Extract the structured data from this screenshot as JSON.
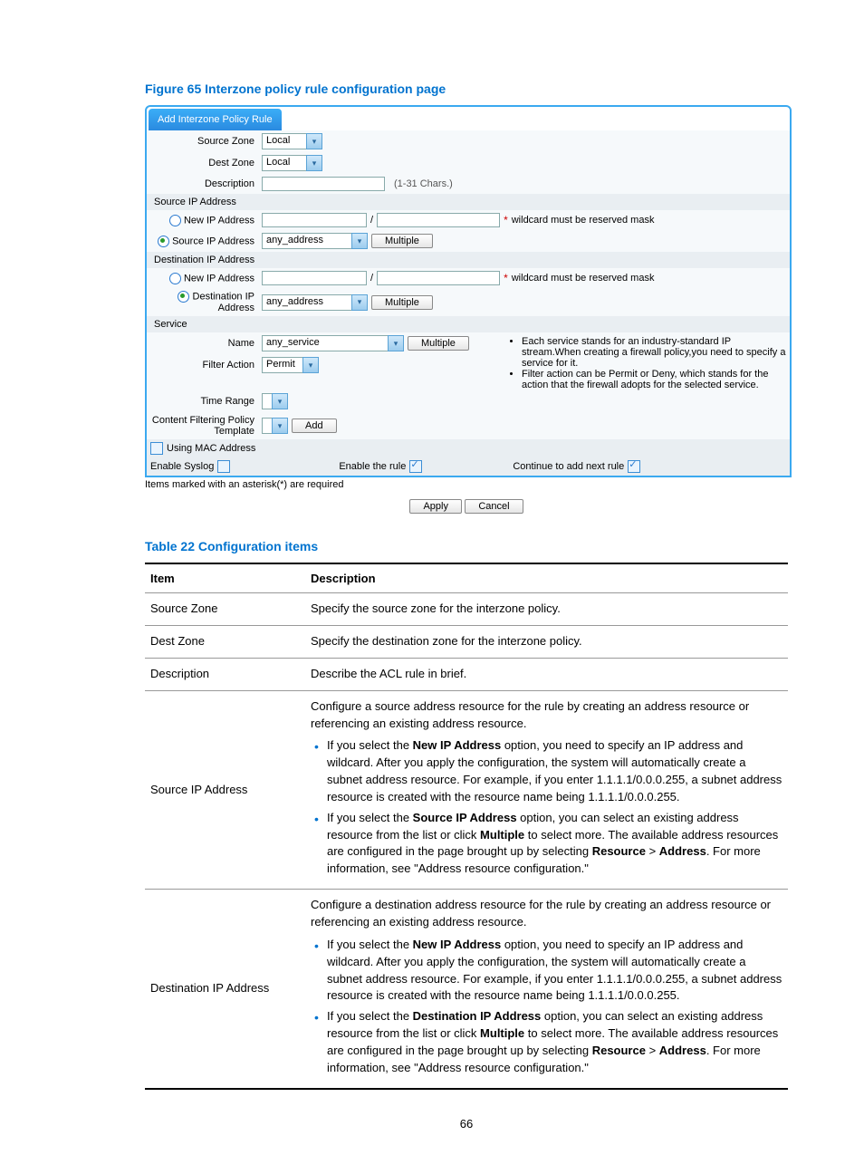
{
  "figure_title": "Figure 65 Interzone policy rule configuration page",
  "table_title": "Table 22 Configuration items",
  "page_num": "66",
  "tab": "Add Interzone Policy Rule",
  "form": {
    "source_zone": {
      "label": "Source Zone",
      "value": "Local"
    },
    "dest_zone": {
      "label": "Dest Zone",
      "value": "Local"
    },
    "description": {
      "label": "Description",
      "hint": "(1-31 Chars.)"
    },
    "src_ip_section": "Source IP Address",
    "new_ip_label": "New IP Address",
    "wildcard_note": "wildcard must be reserved mask",
    "src_ip_addr": {
      "label": "Source IP Address",
      "value": "any_address",
      "multiple": "Multiple"
    },
    "dst_ip_section": "Destination IP Address",
    "dst_ip_addr": {
      "label": "Destination IP Address",
      "value": "any_address",
      "multiple": "Multiple"
    },
    "service_section": "Service",
    "service_name": {
      "label": "Name",
      "value": "any_service",
      "multiple": "Multiple"
    },
    "filter_action": {
      "label": "Filter Action",
      "value": "Permit"
    },
    "time_range": {
      "label": "Time Range"
    },
    "cft": {
      "label": "Content Filtering Policy Template",
      "add": "Add"
    },
    "use_mac": "Using MAC Address",
    "enable_syslog": "Enable Syslog",
    "enable_rule": "Enable the rule",
    "continue": "Continue to add next rule",
    "required": "Items marked with an asterisk(*) are required",
    "apply": "Apply",
    "cancel": "Cancel",
    "svc_notes": [
      "Each service stands for an industry-standard IP stream.When creating a firewall policy,you need to specify a service for it.",
      "Filter action can be Permit or Deny, which stands for the action that the firewall adopts for the selected service."
    ]
  },
  "table": {
    "h1": "Item",
    "h2": "Description",
    "rows": [
      {
        "item": "Source Zone",
        "desc": "Specify the source zone for the interzone policy."
      },
      {
        "item": "Dest Zone",
        "desc": "Specify the destination zone for the interzone policy."
      },
      {
        "item": "Description",
        "desc": "Describe the ACL rule in brief."
      }
    ],
    "src_ip": {
      "item": "Source IP Address",
      "intro": "Configure a source address resource for the rule by creating an address resource or referencing an existing address resource.",
      "b1a": "If you select the ",
      "b1b": "New IP Address",
      "b1c": " option, you need to specify an IP address and wildcard. After you apply the configuration, the system will automatically create a subnet address resource. For example, if you enter 1.1.1.1/0.0.0.255, a subnet address resource is created with the resource name being 1.1.1.1/0.0.0.255.",
      "b2a": "If you select the ",
      "b2b": "Source IP Address",
      "b2c": " option, you can select an existing address resource from the list or click ",
      "b2d": "Multiple",
      "b2e": " to select more. The available address resources are configured in the page brought up by selecting ",
      "b2f": "Resource",
      "b2g": " > ",
      "b2h": "Address",
      "b2i": ". For more information, see \"Address resource configuration.\""
    },
    "dst_ip": {
      "item": "Destination IP Address",
      "intro": "Configure a destination address resource for the rule by creating an address resource or referencing an existing address resource.",
      "b1a": "If you select the ",
      "b1b": "New IP Address",
      "b1c": " option, you need to specify an IP address and wildcard. After you apply the configuration, the system will automatically create a subnet address resource. For example, if you enter 1.1.1.1/0.0.0.255, a subnet address resource is created with the resource name being 1.1.1.1/0.0.0.255.",
      "b2a": "If you select the ",
      "b2b": "Destination IP Address",
      "b2c": " option, you can select an existing address resource from the list or click ",
      "b2d": "Multiple",
      "b2e": " to select more. The available address resources are configured in the page brought up by selecting ",
      "b2f": "Resource",
      "b2g": " > ",
      "b2h": "Address",
      "b2i": ". For more information, see \"Address resource configuration.\""
    }
  }
}
